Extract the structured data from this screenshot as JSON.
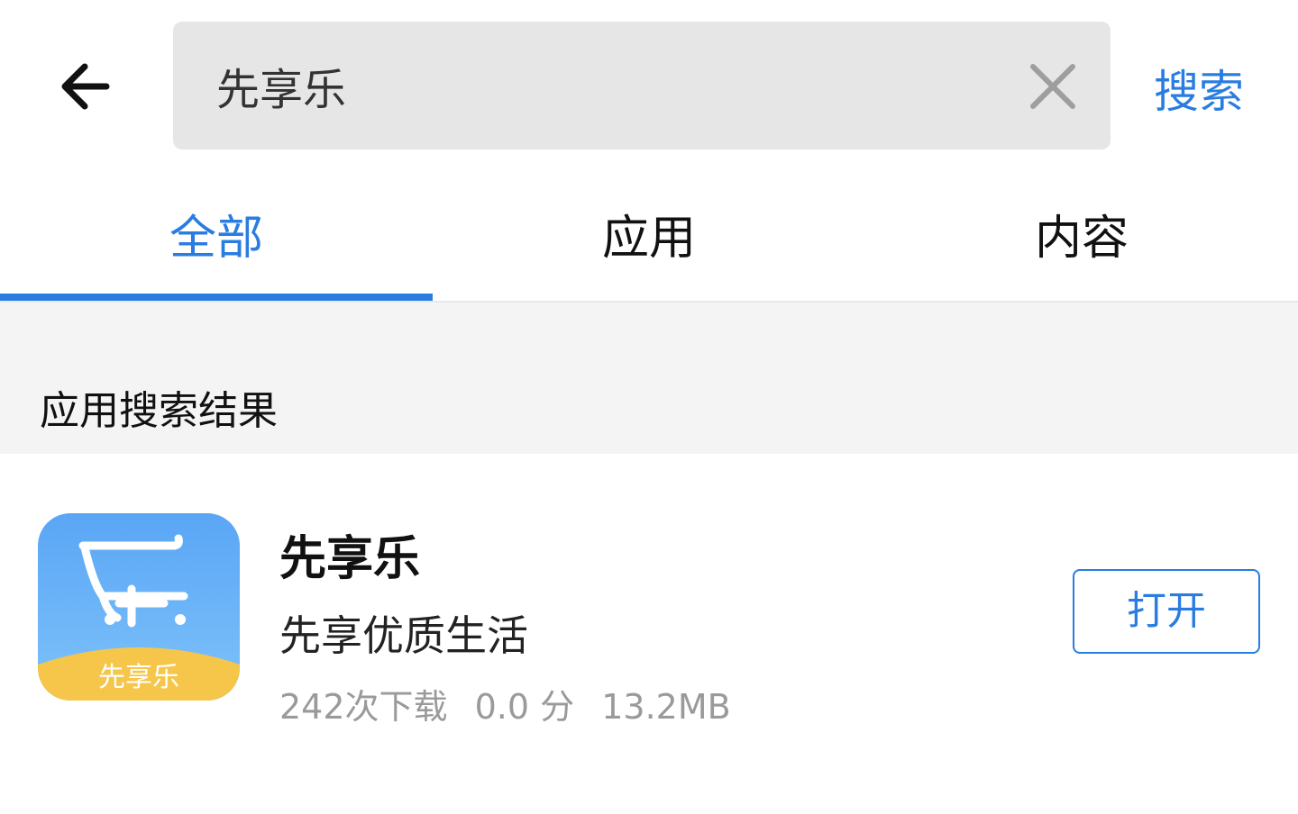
{
  "header": {
    "back_icon": "back-arrow-icon",
    "search": {
      "value": "先享乐",
      "placeholder": ""
    },
    "clear_icon": "close-icon",
    "search_button": "搜索"
  },
  "tabs": [
    {
      "label": "全部",
      "active": true
    },
    {
      "label": "应用",
      "active": false
    },
    {
      "label": "内容",
      "active": false
    }
  ],
  "section": {
    "title": "应用搜索结果"
  },
  "results": [
    {
      "name": "先享乐",
      "description": "先享优质生活",
      "downloads": "242次下载",
      "rating": "0.0 分",
      "size": "13.2MB",
      "icon_text": "先享乐",
      "action": "打开"
    }
  ],
  "colors": {
    "accent": "#2a7de0",
    "search_bg": "#e6e6e6",
    "section_bg": "#f4f4f4",
    "meta_text": "#9a9a9a",
    "icon_gradient_top": "#5aa6f5",
    "icon_band": "#f6c64a"
  }
}
